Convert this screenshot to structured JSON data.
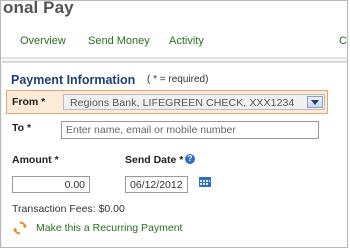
{
  "header": {
    "title": "onal Pay"
  },
  "nav": {
    "tabs": [
      {
        "label": "Overview"
      },
      {
        "label": "Send Money"
      },
      {
        "label": "Activity"
      },
      {
        "label": "Co"
      }
    ]
  },
  "form": {
    "section_title": "Payment Information",
    "required_note": "( * = required)",
    "from": {
      "label": "From *",
      "selected_value": "Regions Bank, LIFEGREEN CHECK, XXX1234"
    },
    "to": {
      "label": "To *",
      "placeholder": "Enter name, email or mobile number",
      "value": ""
    },
    "amount": {
      "label": "Amount *",
      "value": "0.00"
    },
    "send_date": {
      "label": "Send Date *",
      "value": "06/12/2012"
    },
    "transaction_fees": "Transaction Fees: $0.00",
    "recurring_link": "Make this a Recurring Payment"
  },
  "icons": {
    "help": "help-icon",
    "calendar": "calendar-icon",
    "recurring": "refresh-icon",
    "dropdown": "chevron-down-icon"
  },
  "colors": {
    "link_green": "#2a6e22",
    "title_blue": "#1f3f74",
    "from_highlight_bg": "#fdebd7",
    "from_highlight_border": "#e4a77a",
    "help_blue": "#2d6fc2",
    "recurring_orange": "#e8881e"
  }
}
